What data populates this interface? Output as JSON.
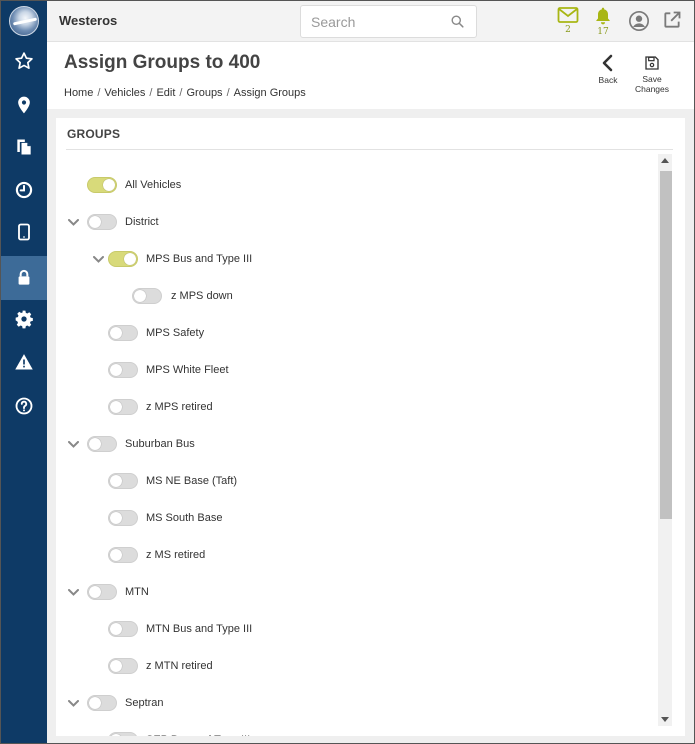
{
  "app": {
    "name": "Westeros"
  },
  "sidebar": {
    "items": [
      {
        "icon": "star-icon"
      },
      {
        "icon": "map-pin-icon"
      },
      {
        "icon": "documents-icon"
      },
      {
        "icon": "clock-icon"
      },
      {
        "icon": "tablet-icon"
      },
      {
        "icon": "lock-icon",
        "active": true
      },
      {
        "icon": "gear-icon"
      },
      {
        "icon": "warning-icon"
      },
      {
        "icon": "help-icon"
      }
    ]
  },
  "search": {
    "placeholder": "Search"
  },
  "notifications": {
    "messages_count": "2",
    "alerts_count": "17",
    "accent": "#a8b614"
  },
  "page": {
    "title": "Assign Groups to 400",
    "breadcrumb": [
      "Home",
      "Vehicles",
      "Edit",
      "Groups",
      "Assign Groups"
    ],
    "back_label": "Back",
    "save_label_1": "Save",
    "save_label_2": "Changes"
  },
  "groups": {
    "header": "GROUPS",
    "items": [
      {
        "label": "All Vehicles",
        "on": true,
        "expandable": false,
        "level": 0
      },
      {
        "label": "District",
        "on": false,
        "expandable": true,
        "level": 0
      },
      {
        "label": "MPS Bus and Type III",
        "on": true,
        "expandable": true,
        "level": 1
      },
      {
        "label": "z MPS down",
        "on": false,
        "expandable": false,
        "level": 2
      },
      {
        "label": "MPS Safety",
        "on": false,
        "expandable": false,
        "level": 1
      },
      {
        "label": "MPS White Fleet",
        "on": false,
        "expandable": false,
        "level": 1
      },
      {
        "label": "z MPS retired",
        "on": false,
        "expandable": false,
        "level": 1
      },
      {
        "label": "Suburban Bus",
        "on": false,
        "expandable": true,
        "level": 0
      },
      {
        "label": "MS NE Base (Taft)",
        "on": false,
        "expandable": false,
        "level": 1
      },
      {
        "label": "MS South Base",
        "on": false,
        "expandable": false,
        "level": 1
      },
      {
        "label": "z MS retired",
        "on": false,
        "expandable": false,
        "level": 1
      },
      {
        "label": "MTN",
        "on": false,
        "expandable": true,
        "level": 0
      },
      {
        "label": "MTN Bus and Type III",
        "on": false,
        "expandable": false,
        "level": 1
      },
      {
        "label": "z MTN retired",
        "on": false,
        "expandable": false,
        "level": 1
      },
      {
        "label": "Septran",
        "on": false,
        "expandable": true,
        "level": 0
      },
      {
        "label": "SEP Bus and Type III",
        "on": false,
        "expandable": false,
        "level": 1
      }
    ]
  },
  "colors": {
    "sidebar": "#0e3a66",
    "sidebar_active": "#3d6b98",
    "toggle_on": "#d8da7a"
  }
}
